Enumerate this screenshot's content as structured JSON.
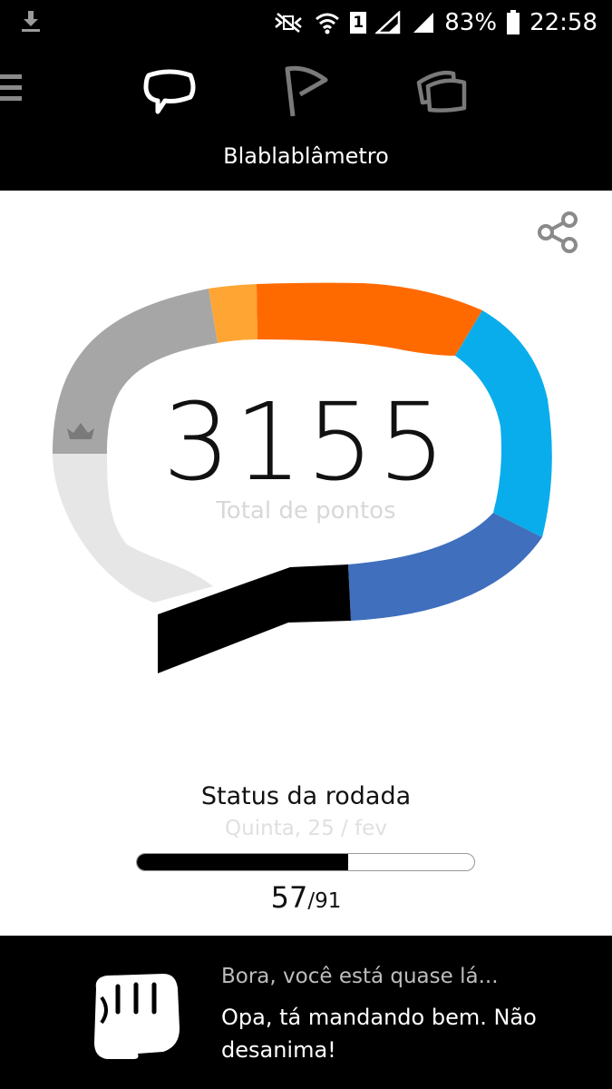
{
  "status_bar": {
    "battery": "83%",
    "time": "22:58",
    "sim_slot": "1",
    "icons": [
      "download-icon",
      "mute-icon",
      "wifi-icon",
      "signal-icon",
      "battery-icon"
    ]
  },
  "header": {
    "title": "Blablablâmetro",
    "tabs": [
      {
        "icon": "speech-bubble-icon",
        "active": true
      },
      {
        "icon": "flag-icon",
        "active": false
      },
      {
        "icon": "cards-icon",
        "active": false
      }
    ]
  },
  "score": {
    "total": "3155",
    "label": "Total de pontos",
    "segments": [
      {
        "color": "#e6e6e6"
      },
      {
        "color": "#a6a6a6"
      },
      {
        "color": "#ffa534"
      },
      {
        "color": "#ff6a00"
      },
      {
        "color": "#0aadec"
      },
      {
        "color": "#3f6fbd"
      },
      {
        "color": "#000000"
      }
    ]
  },
  "round": {
    "title": "Status da rodada",
    "date": "Quinta, 25 / fev",
    "done": "57",
    "separator": "/",
    "total": "91",
    "progress_fraction": 0.626
  },
  "footer": {
    "heading": "Bora, você está quase lá...",
    "message": "Opa, tá mandando bem. Não desanima!",
    "icon": "fist-icon"
  }
}
